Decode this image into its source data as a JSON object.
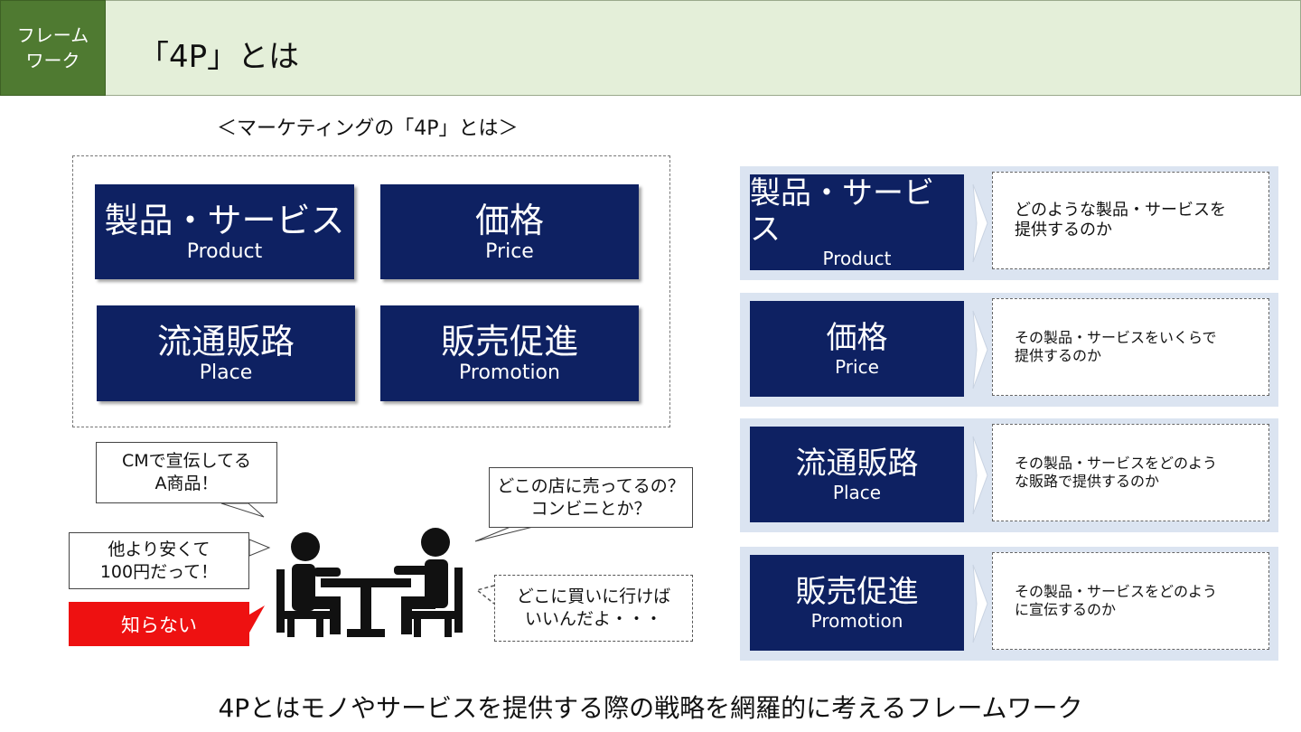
{
  "header": {
    "tag_line1": "フレーム",
    "tag_line2": "ワーク",
    "title": "「4P」とは"
  },
  "subtitle": "＜マーケティングの「4P」とは＞",
  "grid": [
    {
      "jp": "製品・サービス",
      "en": "Product"
    },
    {
      "jp": "価格",
      "en": "Price"
    },
    {
      "jp": "流通販路",
      "en": "Place"
    },
    {
      "jp": "販売促進",
      "en": "Promotion"
    }
  ],
  "bubbles": {
    "cm": {
      "line1": "CMで宣伝してる",
      "line2": "A商品！"
    },
    "cheap": {
      "line1": "他より安くて",
      "line2": "100円だって！"
    },
    "where_sold": {
      "line1": "どこの店に売ってるの？",
      "line2": "コンビニとか？"
    },
    "where_buy": {
      "line1": "どこに買いに行けば",
      "line2": "いいんだよ・・・"
    },
    "unknown": "知らない"
  },
  "rows": [
    {
      "jp": "製品・サービス",
      "en": "Product",
      "desc1": "どのような製品・サービスを",
      "desc2": "提供するのか"
    },
    {
      "jp": "価格",
      "en": "Price",
      "desc1": "その製品・サービスをいくらで",
      "desc2": "提供するのか"
    },
    {
      "jp": "流通販路",
      "en": "Place",
      "desc1": "その製品・サービスをどのよう",
      "desc2": "な販路で提供するのか"
    },
    {
      "jp": "販売促進",
      "en": "Promotion",
      "desc1": "その製品・サービスをどのよう",
      "desc2": "に宣伝するのか"
    }
  ],
  "footer": "4Pとはモノやサービスを提供する際の戦略を網羅的に考えるフレームワーク",
  "colors": {
    "navy": "#0e2162",
    "green_tag": "#4f7a31",
    "title_bg": "#e4efd9",
    "row_bg": "#dbe4f1",
    "alert_red": "#ee1111"
  }
}
